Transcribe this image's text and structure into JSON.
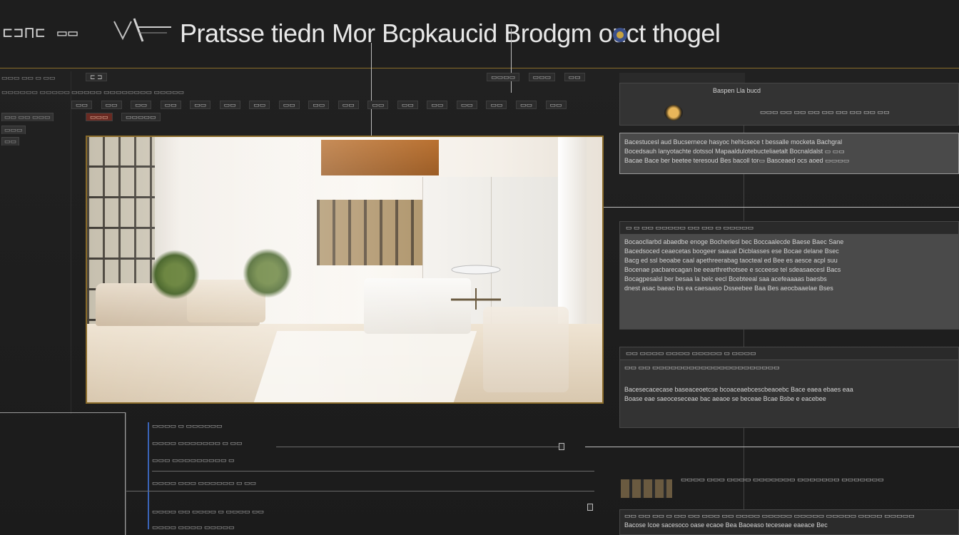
{
  "app": {
    "title": "Pratsse tiedn Mor Bcpkaucid Brodgm ouct thogel",
    "title_deco": "⊏⊐⊓⊏ ▭▭"
  },
  "colors": {
    "accent": "#8a6b2a",
    "background": "#1f1f1f",
    "panel": "#333333",
    "highlight": "#3a64b8"
  },
  "left_col": {
    "rows": [
      "▭▭▭ ▭▭ ▭ ▭▭",
      "▭▭▭▭▭▭ ▭▭▭▭▭",
      "▭▭ ▭▭ ▭▭▭",
      "▭▭▭",
      "▭▭"
    ]
  },
  "toolbar": {
    "row1": [
      "⊏ ⊐",
      "▭▭▭▭",
      "▭▭▭",
      "▭▭"
    ],
    "row2": [
      "▭▭▭▭▭ ▭▭▭▭▭▭▭▭ ▭▭▭▭▭"
    ],
    "row3_buttons": [
      "▭▭",
      "▭▭",
      "▭▭",
      "▭▭",
      "▭▭",
      "▭▭",
      "▭▭",
      "▭▭",
      "▭▭",
      "▭▭",
      "▭▭",
      "▭▭",
      "▭▭",
      "▭▭",
      "▭▭",
      "▭▭",
      "▭▭",
      "▭▭",
      "▭▭"
    ],
    "row4_buttons": [
      "▭▭▭",
      "▭▭▭▭▭"
    ]
  },
  "right_panels": {
    "top": {
      "header": "Baspen Lla bucd",
      "row": "▭▭▭ ▭▭ ▭▭ ▭▭ ▭▭ ▭▭ ▭▭ ▭▭ ▭▭"
    },
    "desc": {
      "lines": [
        "Bacestucesl aud Bucsernece hasyoc hehicsece t bessalle mocketa Bachgral",
        "Bocedsauh lanyotachte dotssol Mapaaldulotebucteliaetalt Bocnaldalst ▭ ▭▭",
        "Bacae Bace ber beetee teresoud Bes bacoll tor▭ Basceaed ocs aoed ▭▭▭▭"
      ]
    },
    "props": {
      "header": "▭ ▭ ▭▭ ▭▭▭▭▭ ▭▭ ▭▭ ▭ ▭▭▭▭▭",
      "lines": [
        "Bocaocllarbd abaedbe enoge Bocherlesl bec Boccaalecde Baese Baec Sane",
        "Bacedsoced ceaecetas boogeer saaual Dicblasses ese Bocae delane Bsec",
        "Bacg ed ssl beoabe caal apethreerabag taocteal ed Bee es aesce acpl suu",
        "Bocenae pacbarecagan be eearthrethotsee e scceese tel sdeasaecesl Bacs",
        "Bocagpesalsl ber besaa la belc eecl Bcebteeal saa acefeaaaas baesbs",
        "dnest asac baeao bs ea caesaaso Dsseebee Baa Bes aeocbaaelae Bses"
      ]
    },
    "effects": {
      "header": "▭▭ ▭▭▭▭ ▭▭▭▭ ▭▭▭▭▭ ▭ ▭▭▭▭",
      "row": "▭▭ ▭▭ ▭▭▭▭▭▭▭▭▭▭▭▭▭▭▭▭▭▭▭▭▭",
      "lines": [
        "Bacesecacecase baseaceoetcse bcoaceaebcescbeaoebc Bace eaea ebaes eaa",
        "Boase eae saeoceseceae bac aeaoe se beceae Bcae Bsbe e eacebee"
      ]
    },
    "bottom": {
      "header": "▭▭▭▭ ▭▭▭ ▭▭▭▭ ▭▭▭▭▭▭▭ ▭▭▭▭▭▭▭ ▭▭▭▭▭▭▭",
      "lines": [
        "▭▭ ▭▭ ▭▭ ▭ ▭▭ ▭▭ ▭▭▭ ▭▭ ▭▭▭▭ ▭▭▭▭▭ ▭▭▭▭▭ ▭▭▭▭▭ ▭▭▭▭ ▭▭▭▭▭",
        "Bacose Icoe sacesoco oase ecaoe Bea Baoeaso teceseae eaeace Bec"
      ]
    }
  },
  "timeline": {
    "rows": [
      "▭▭▭▭ ▭ ▭▭▭▭▭▭",
      "▭▭▭▭ ▭▭▭▭▭▭▭ ▭ ▭▭",
      "▭▭▭ ▭▭▭▭▭▭▭▭▭ ▭",
      "▭▭▭▭ ▭▭▭ ▭▭▭▭▭▭ ▭ ▭▭",
      "▭▭▭▭ ▭▭ ▭▭▭▭ ▭ ▭▭▭▭ ▭▭",
      "▭▭▭▭ ▭▭▭▭ ▭▭▭▭▭"
    ]
  }
}
